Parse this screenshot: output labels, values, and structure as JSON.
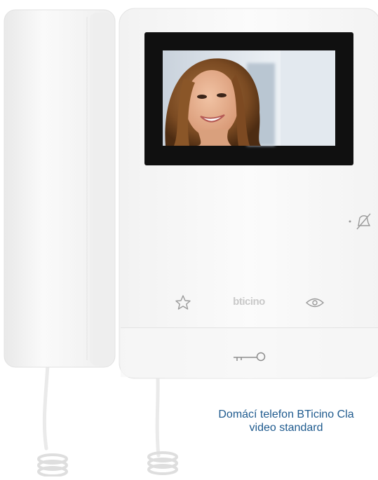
{
  "product": {
    "brand_logo": "bticino",
    "caption_line1": "Domácí telefon BTicino Cla",
    "caption_line2": "video standard"
  },
  "icons": {
    "favorite": "star-icon",
    "mute": "bell-muted-icon",
    "view": "eye-icon",
    "door_lock": "key-icon"
  },
  "colors": {
    "caption_text": "#1e5a8e",
    "device_body": "#f6f6f6",
    "screen_bezel": "#111111",
    "control_icon": "#9a9a9a"
  }
}
